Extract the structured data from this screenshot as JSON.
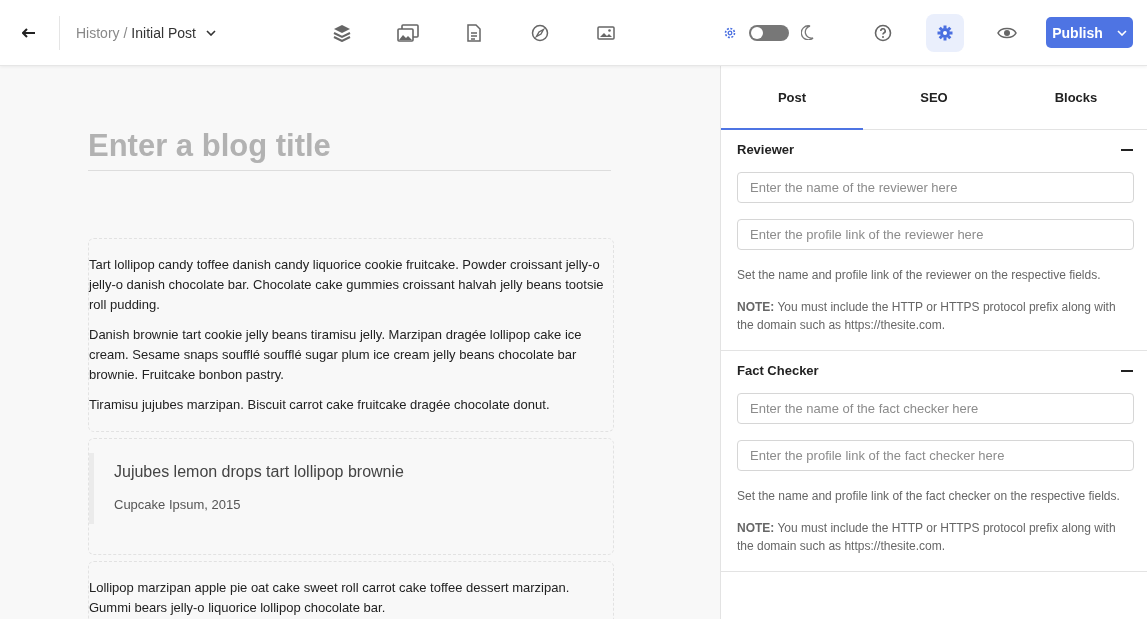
{
  "header": {
    "breadcrumb": {
      "parent": "History /",
      "current": "Initial Post"
    },
    "tools": [
      {
        "kind": "layers",
        "selected": false
      },
      {
        "kind": "gallery",
        "selected": false
      },
      {
        "kind": "document",
        "selected": false
      },
      {
        "kind": "compass",
        "selected": false
      },
      {
        "kind": "image",
        "selected": false
      }
    ],
    "theme_toggle": {
      "on": false
    },
    "actions": [
      {
        "kind": "help",
        "selected": false
      },
      {
        "kind": "settings",
        "selected": true
      },
      {
        "kind": "preview",
        "selected": false
      }
    ],
    "publish": {
      "label": "Publish"
    }
  },
  "editor": {
    "title_placeholder": "Enter a blog title",
    "blocks": [
      {
        "kind": "paragraphs",
        "paragraphs": [
          "Tart lollipop candy toffee danish candy liquorice cookie fruitcake. Powder croissant jelly-o jelly-o danish chocolate bar. Chocolate cake gummies croissant halvah jelly beans tootsie roll pudding.",
          "Danish brownie tart cookie jelly beans tiramisu jelly. Marzipan dragée lollipop cake ice cream. Sesame snaps soufflé soufflé sugar plum ice cream jelly beans chocolate bar brownie. Fruitcake bonbon pastry.",
          "Tiramisu jujubes marzipan. Biscuit carrot cake fruitcake dragée chocolate donut."
        ]
      },
      {
        "kind": "quote",
        "text": "Jujubes lemon drops tart lollipop brownie",
        "citation": "Cupcake Ipsum, 2015"
      },
      {
        "kind": "paragraphs",
        "paragraphs": [
          "Lollipop marzipan apple pie oat cake sweet roll carrot cake toffee dessert marzipan. Gummi bears jelly-o liquorice lollipop chocolate bar."
        ]
      }
    ]
  },
  "sidebar": {
    "tabs": [
      {
        "label": "Post",
        "selected": true
      },
      {
        "label": "SEO",
        "selected": false
      },
      {
        "label": "Blocks",
        "selected": false
      }
    ],
    "sections": [
      {
        "title": "Reviewer",
        "expanded": true,
        "fields": [
          {
            "placeholder": "Enter the name of the reviewer here"
          },
          {
            "placeholder": "Enter the profile link of the reviewer here"
          }
        ],
        "help": "Set the name and profile link of the reviewer on the respective fields.",
        "note": "**NOTE:** You must include the HTTP or HTTPS protocol prefix along with the domain such as https://thesite.com."
      },
      {
        "title": "Fact Checker",
        "expanded": true,
        "fields": [
          {
            "placeholder": "Enter the name of the fact checker here"
          },
          {
            "placeholder": "Enter the profile link of the fact checker here"
          }
        ],
        "help": "Set the name and profile link of the fact checker on the respective fields.",
        "note": "**NOTE:** You must include the HTTP or HTTPS protocol prefix along with the domain such as https://thesite.com."
      }
    ]
  }
}
